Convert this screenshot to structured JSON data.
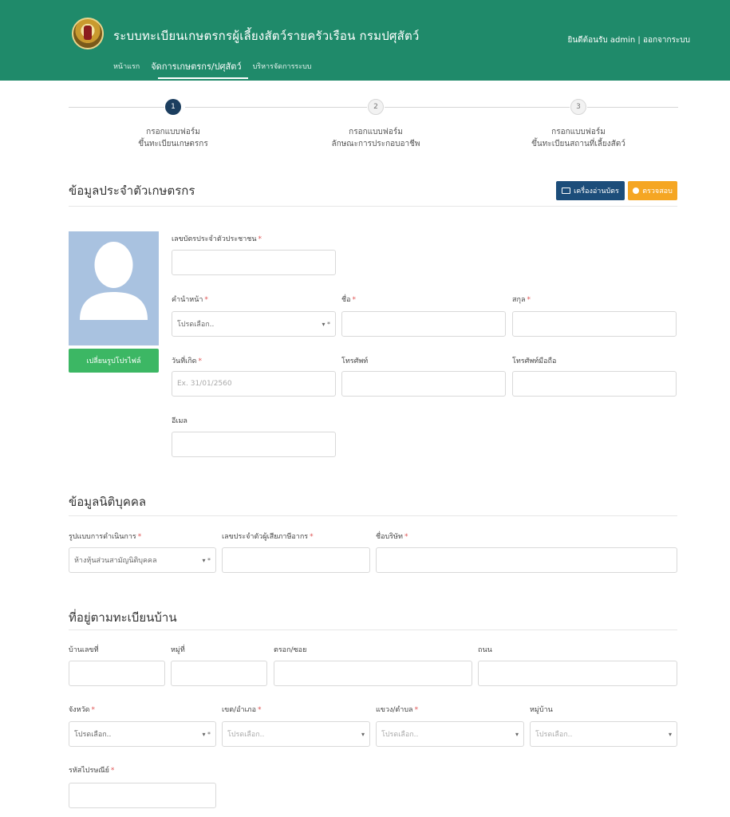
{
  "header": {
    "title": "ระบบทะเบียนเกษตรกรผู้เลี้ยงสัตว์รายครัวเรือน กรมปศุสัตว์",
    "welcome": "ยินดีต้อนรับ admin | ออกจากระบบ",
    "nav": [
      {
        "label": "หน้าแรก"
      },
      {
        "label": "จัดการเกษตรกร/ปศุสัตว์"
      },
      {
        "label": "บริหารจัดการระบบ"
      }
    ]
  },
  "stepper": {
    "steps": [
      {
        "number": "1",
        "line1": "กรอกแบบฟอร์ม",
        "line2": "ขึ้นทะเบียนเกษตรกร"
      },
      {
        "number": "2",
        "line1": "กรอกแบบฟอร์ม",
        "line2": "ลักษณะการประกอบอาชีพ"
      },
      {
        "number": "3",
        "line1": "กรอกแบบฟอร์ม",
        "line2": "ขึ้นทะเบียนสถานที่เลี้ยงสัตว์"
      }
    ]
  },
  "personal": {
    "title": "ข้อมูลประจำตัวเกษตรกร",
    "card_reader_button": "เครื่องอ่านบัตร",
    "check_button": "ตรวจสอบ",
    "change_avatar_button": "เปลี่ยนรูปโปรไฟล์",
    "id_label": "เลขบัตรประจำตัวประชาชน",
    "prefix_label": "คำนำหน้า",
    "prefix_value": "โปรดเลือก..",
    "firstname_label": "ชื่อ",
    "lastname_label": "สกุล",
    "birthdate_label": "วันที่เกิด",
    "birthdate_placeholder": "Ex. 31/01/2560",
    "phone_label": "โทรศัพท์",
    "mobile_label": "โทรศัพท์มือถือ",
    "email_label": "อีเมล"
  },
  "juristic": {
    "title": "ข้อมูลนิติบุคคล",
    "type_label": "รูปแบบการดำเนินการ",
    "type_value": "ห้างหุ้นส่วนสามัญนิติบุคคล",
    "taxid_label": "เลขประจำตัวผู้เสียภาษีอากร",
    "company_label": "ชื่อบริษัท"
  },
  "address": {
    "title": "ที่อยู่ตามทะเบียนบ้าน",
    "house_label": "บ้านเลขที่",
    "moo_label": "หมู่ที่",
    "soi_label": "ตรอก/ซอย",
    "road_label": "ถนน",
    "province_label": "จังหวัด",
    "province_value": "โปรดเลือก..",
    "district_label": "เขต/อำเภอ",
    "district_value": "โปรดเลือก..",
    "subdistrict_label": "แขวง/ตำบล",
    "subdistrict_value": "โปรดเลือก..",
    "village_label": "หมู่บ้าน",
    "village_value": "โปรดเลือก..",
    "postcode_label": "รหัสไปรษณีย์"
  },
  "colors": {
    "header": "#1f8a6a",
    "step_active": "#1c3e5f",
    "reader_button": "#1c4d7a",
    "check_button": "#f5a623",
    "avatar_button": "#3cb764",
    "required": "#e05555"
  }
}
